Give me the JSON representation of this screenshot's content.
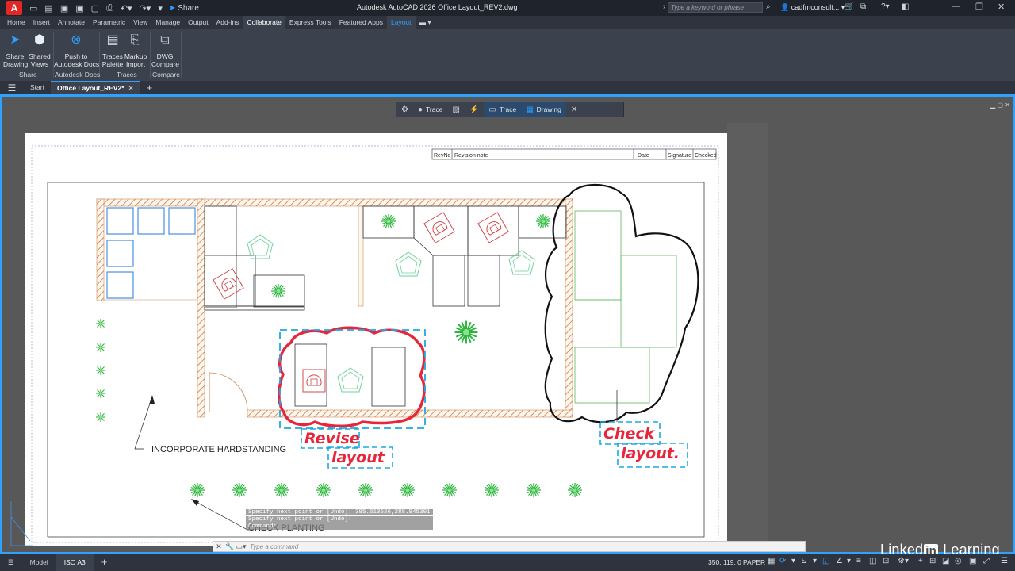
{
  "titlebar": {
    "app_logo": "A",
    "share_label": "Share",
    "title": "Autodesk AutoCAD 2026    Office Layout_REV2.dwg",
    "search_placeholder": "Type a keyword or phrase",
    "user": "cadfmconsult..."
  },
  "ribbon_tabs": [
    "Home",
    "Insert",
    "Annotate",
    "Parametric",
    "View",
    "Manage",
    "Output",
    "Add-ins",
    "Collaborate",
    "Express Tools",
    "Featured Apps",
    "Layout"
  ],
  "active_ribbon_tab": "Collaborate",
  "ribbon": {
    "share_drawing": "Share\nDrawing",
    "shared_views": "Shared\nViews",
    "push_to_docs": "Push to\nAutodesk Docs",
    "traces_palette": "Traces\nPalette",
    "markup_import": "Markup\nImport",
    "dwg_compare": "DWG\nCompare",
    "group_share": "Share",
    "group_docs": "Autodesk Docs",
    "group_traces": "Traces",
    "group_compare": "Compare"
  },
  "file_tabs": {
    "start": "Start",
    "active": "Office Layout_REV2*"
  },
  "trace_toolbar": {
    "trace_label": "Trace",
    "trace2_label": "Trace",
    "drawing_label": "Drawing"
  },
  "title_block": {
    "revno": "RevNo",
    "revision_note": "Revision note",
    "date": "Date",
    "signature": "Signature",
    "checked": "Checked"
  },
  "annotations": {
    "hardstanding": "INCORPORATE HARDSTANDING",
    "planting": "CHECK PLANTING",
    "revise": "Revise",
    "layout1": "layout",
    "check": "Check",
    "layout2": "layout."
  },
  "command": {
    "history1": "Specify next point or [Undo]: 395.613526,288.945301",
    "history2": "Specify next point or [Undo]:",
    "history3": "Command:",
    "placeholder": "Type a command"
  },
  "watermark": "LinkedIn Learning",
  "status": {
    "model_tab": "Model",
    "layout_tab": "ISO A3",
    "coords": "350, 119, 0",
    "space": "PAPER"
  },
  "colors": {
    "accent": "#2fa1ff",
    "markup_red": "#e8253a",
    "markup_cyan": "#1ea8e0",
    "plant_green": "#27b53a"
  }
}
